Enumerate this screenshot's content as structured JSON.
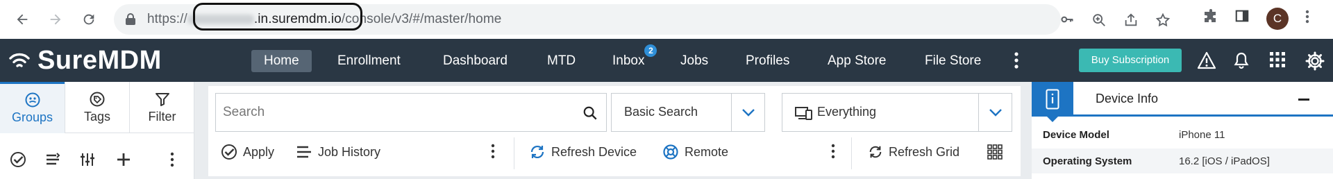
{
  "browser": {
    "url_scheme": "https://",
    "url_host": ".in.suremdm.io",
    "url_path": "/console/v3/#/master/home",
    "avatar_initial": "C"
  },
  "app": {
    "logo_text": "SureMDM",
    "nav_items": [
      {
        "label": "Home",
        "active": true
      },
      {
        "label": "Enrollment"
      },
      {
        "label": "Dashboard"
      },
      {
        "label": "MTD"
      },
      {
        "label": "Inbox",
        "badge": "2"
      },
      {
        "label": "Jobs"
      },
      {
        "label": "Profiles"
      },
      {
        "label": "App Store"
      },
      {
        "label": "File Store"
      }
    ],
    "buy_button": "Buy Subscription",
    "accent_color": "#1d74c3",
    "nav_bg": "#2a3744",
    "buy_color": "#3bb9b3"
  },
  "left_panel": {
    "tabs": [
      {
        "label": "Groups",
        "icon": "groups-icon",
        "active": true
      },
      {
        "label": "Tags",
        "icon": "tag-icon"
      },
      {
        "label": "Filter",
        "icon": "filter-icon"
      }
    ]
  },
  "search": {
    "placeholder": "Search",
    "search_type": "Basic Search",
    "scope": "Everything"
  },
  "actions": {
    "apply": "Apply",
    "job_history": "Job History",
    "refresh_device": "Refresh Device",
    "remote": "Remote",
    "refresh_grid": "Refresh Grid"
  },
  "device_info": {
    "title": "Device Info",
    "rows": [
      {
        "key": "Device Model",
        "value": "iPhone 11"
      },
      {
        "key": "Operating System",
        "value": "16.2 [iOS / iPadOS]"
      }
    ]
  }
}
